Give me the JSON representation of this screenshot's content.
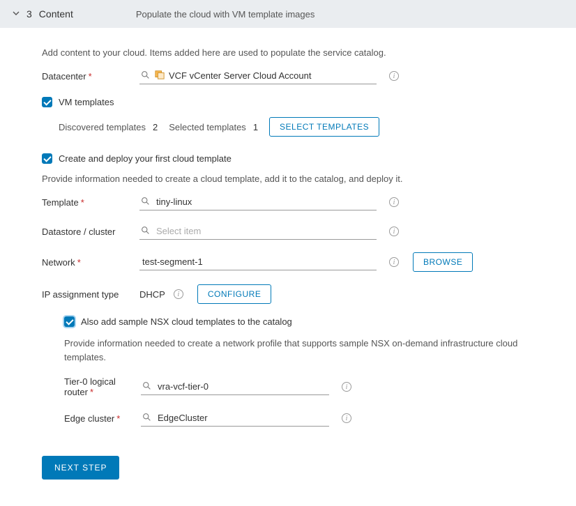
{
  "header": {
    "step_num": "3",
    "title": "Content",
    "subtitle": "Populate the cloud with VM template images"
  },
  "intro": "Add content to your cloud. Items added here are used to populate the service catalog.",
  "datacenter": {
    "label": "Datacenter",
    "value": "VCF vCenter Server Cloud Account"
  },
  "vm_templates": {
    "label": "VM templates",
    "discovered_label": "Discovered templates",
    "discovered_count": "2",
    "selected_label": "Selected templates",
    "selected_count": "1",
    "select_btn": "Select Templates"
  },
  "create_deploy": {
    "label": "Create and deploy your first cloud template",
    "desc": "Provide information needed to create a cloud template, add it to the catalog, and deploy it."
  },
  "template": {
    "label": "Template",
    "value": "tiny-linux"
  },
  "datastore": {
    "label": "Datastore / cluster",
    "placeholder": "Select item"
  },
  "network": {
    "label": "Network",
    "value": "test-segment-1",
    "browse_btn": "BROWSE"
  },
  "ip": {
    "label": "IP assignment type",
    "value": "DHCP",
    "configure_btn": "CONFIGURE"
  },
  "nsx": {
    "cb_label": "Also add sample NSX cloud templates to the catalog",
    "desc": "Provide information needed to create a network profile that supports sample NSX on-demand infrastructure cloud templates.",
    "tier0_label": "Tier-0 logical router",
    "tier0_value": "vra-vcf-tier-0",
    "edge_label": "Edge cluster",
    "edge_value": "EdgeCluster"
  },
  "next_btn": "Next Step"
}
